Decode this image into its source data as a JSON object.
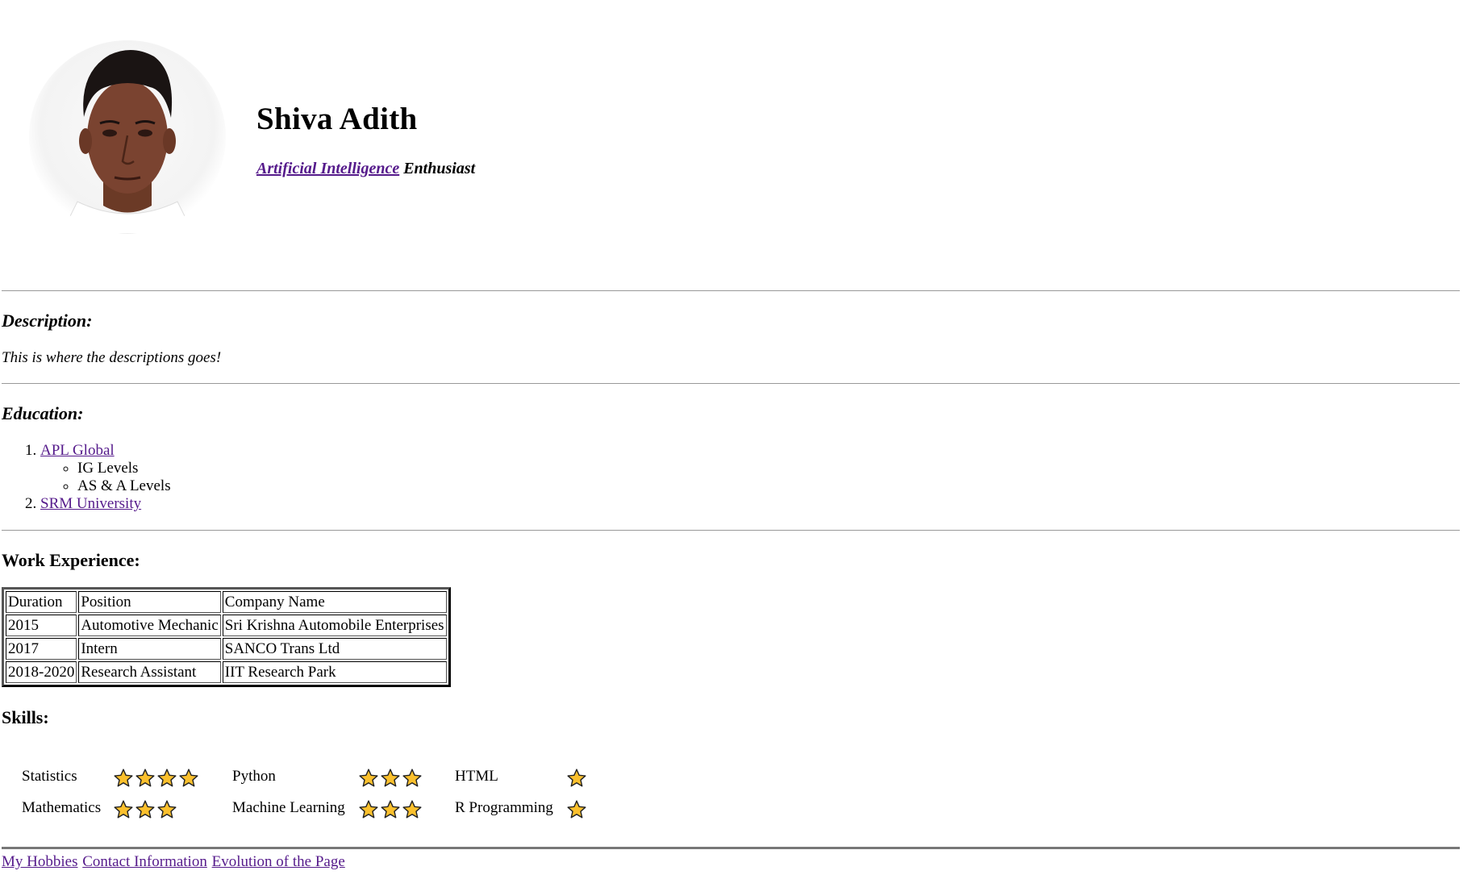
{
  "profile": {
    "name": "Shiva Adith",
    "tagline_link": "Artificial Intelligence",
    "tagline_rest": " Enthusiast"
  },
  "description": {
    "heading": "Description:",
    "text": "This is where the descriptions goes!"
  },
  "education": {
    "heading": "Education:",
    "items": [
      {
        "label": "APL Global",
        "sub": [
          "IG Levels",
          "AS & A Levels"
        ]
      },
      {
        "label": "SRM University"
      }
    ]
  },
  "work": {
    "heading": "Work Experience:",
    "headers": [
      "Duration",
      "Position",
      "Company Name"
    ],
    "rows": [
      [
        "2015",
        "Automotive Mechanic",
        "Sri Krishna Automobile Enterprises"
      ],
      [
        "2017",
        "Intern",
        "SANCO Trans Ltd"
      ],
      [
        "2018-2020",
        "Research Assistant",
        "IIT Research Park"
      ]
    ]
  },
  "skills": {
    "heading": "Skills:",
    "items": [
      {
        "name": "Statistics",
        "stars": 4
      },
      {
        "name": "Python",
        "stars": 3
      },
      {
        "name": "HTML",
        "stars": 1
      },
      {
        "name": "Mathematics",
        "stars": 3
      },
      {
        "name": "Machine Learning",
        "stars": 3
      },
      {
        "name": "R Programming",
        "stars": 1
      }
    ],
    "star_color": "#fbc02d"
  },
  "footer": {
    "links": [
      "My Hobbies",
      "Contact Information",
      "Evolution of the Page"
    ]
  }
}
